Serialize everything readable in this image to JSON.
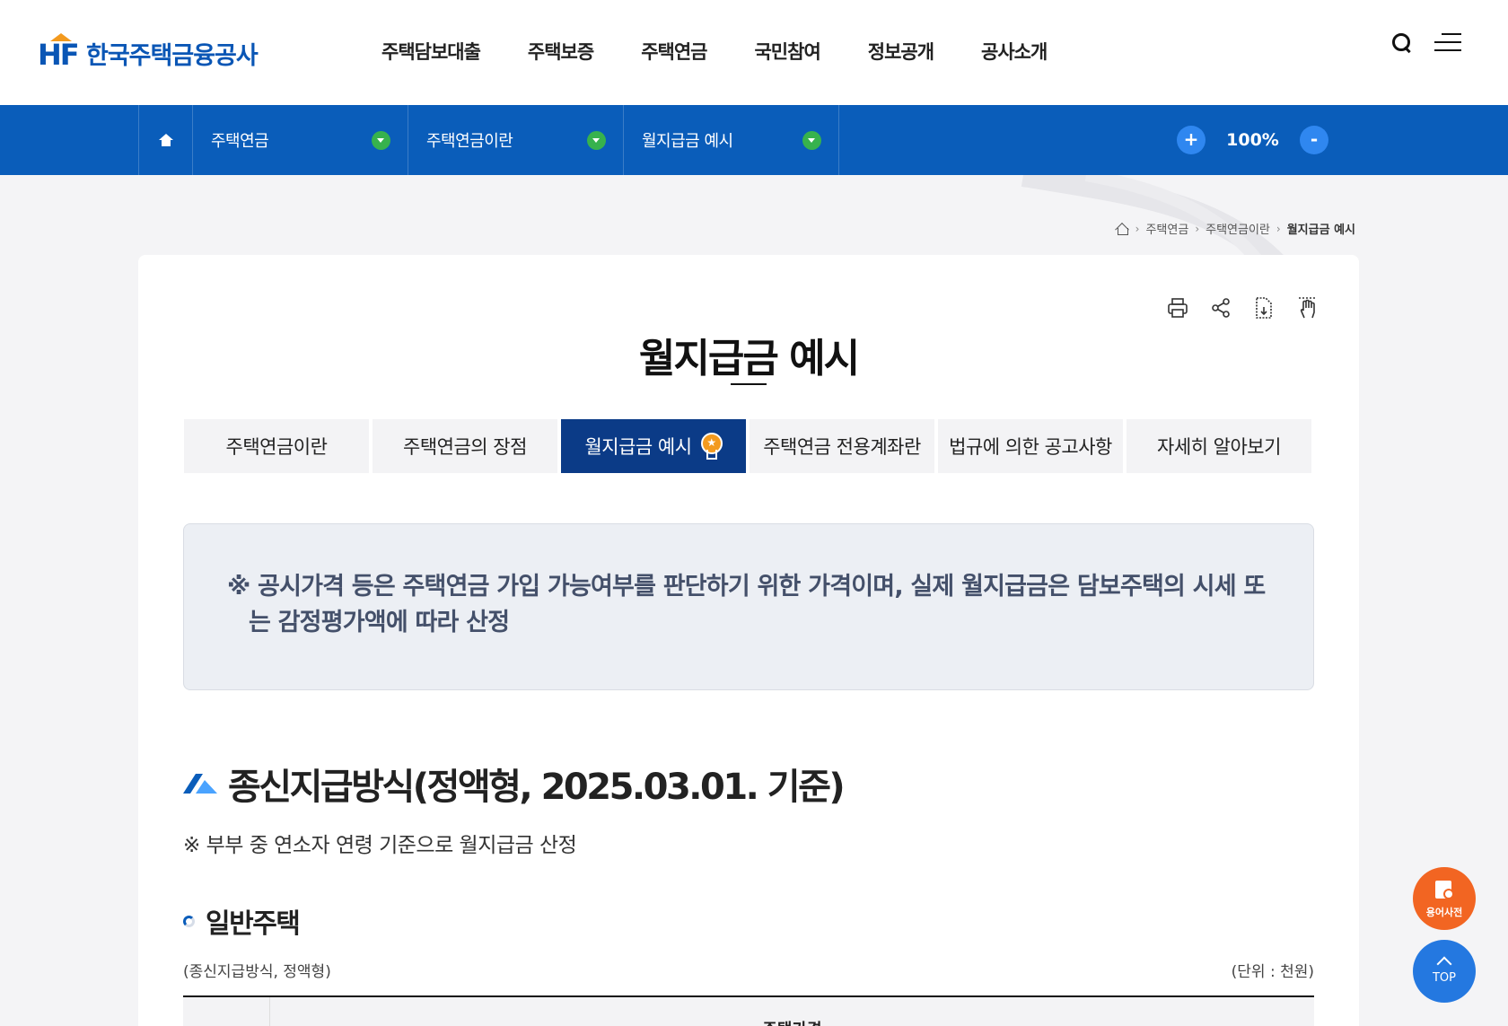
{
  "header": {
    "logo_text": "한국주택금융공사",
    "logo_mark": "HF",
    "nav": [
      "주택담보대출",
      "주택보증",
      "주택연금",
      "국민참여",
      "정보공개",
      "공사소개"
    ]
  },
  "location_bar": {
    "items": [
      "주택연금",
      "주택연금이란",
      "월지급금 예시"
    ],
    "zoom_in": "+",
    "zoom_level": "100%",
    "zoom_out": "-"
  },
  "breadcrumb": {
    "items": [
      "주택연금",
      "주택연금이란"
    ],
    "current": "월지급금 예시"
  },
  "page": {
    "title": "월지급금 예시",
    "tabs": [
      {
        "label": "주택연금이란",
        "active": false
      },
      {
        "label": "주택연금의 장점",
        "active": false
      },
      {
        "label": "월지급금 예시",
        "active": true
      },
      {
        "label": "주택연금 전용계좌란",
        "active": false
      },
      {
        "label": "법규에 의한 공고사항",
        "active": false
      },
      {
        "label": "자세히 알아보기",
        "active": false
      }
    ],
    "notice": "※ 공시가격 등은 주택연금 가입 가능여부를 판단하기 위한 가격이며, 실제 월지급금은 담보주택의 시세 또는 감정평가액에 따라 산정",
    "section_title": "종신지급방식(정액형, 2025.03.01. 기준)",
    "section_note": "※ 부부 중 연소자 연령 기준으로 월지급금 산정",
    "sub_title": "일반주택",
    "table_caption": "(종신지급방식, 정액형)",
    "table_unit": "(단위 : 천원)",
    "table_header": "주택가격"
  },
  "floating": {
    "dictionary": "용어사전",
    "top": "TOP"
  },
  "colors": {
    "brand_blue": "#0a5dba",
    "active_tab": "#0b3b87",
    "dropdown_green": "#37b24d",
    "dictionary_orange": "#f26522"
  }
}
